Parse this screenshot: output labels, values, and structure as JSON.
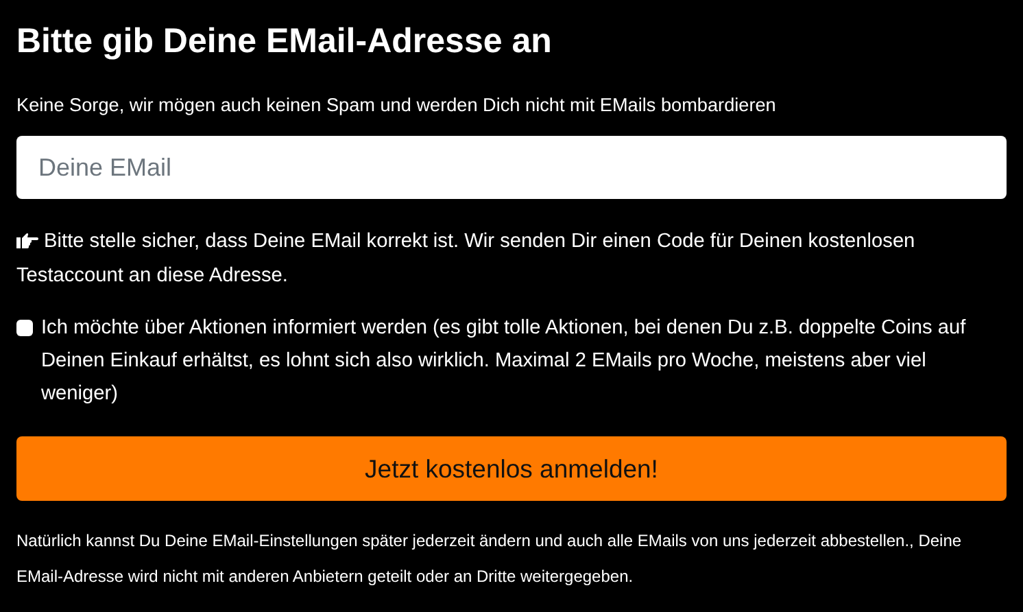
{
  "title": "Bitte gib Deine EMail-Adresse an",
  "subtitle": "Keine Sorge, wir mögen auch keinen Spam und werden Dich nicht mit EMails bombardieren",
  "email_field": {
    "placeholder": "Deine EMail"
  },
  "hint": "Bitte stelle sicher, dass Deine EMail korrekt ist. Wir senden Dir einen Code für Deinen kostenlosen Testaccount an diese Adresse.",
  "newsletter_option": {
    "label": "Ich möchte über Aktionen informiert werden (es gibt tolle Aktionen, bei denen Du z.B. doppelte Coins auf Deinen Einkauf erhältst, es lohnt sich also wirklich. Maximal 2 EMails pro Woche, meistens aber viel weniger)",
    "checked": false
  },
  "submit_button": "Jetzt kostenlos anmelden!",
  "footer_note": "Natürlich kannst Du Deine EMail-Einstellungen später jederzeit ändern und auch alle EMails von uns jederzeit abbestellen., Deine EMail-Adresse wird nicht mit anderen Anbietern geteilt oder an Dritte weitergegeben."
}
